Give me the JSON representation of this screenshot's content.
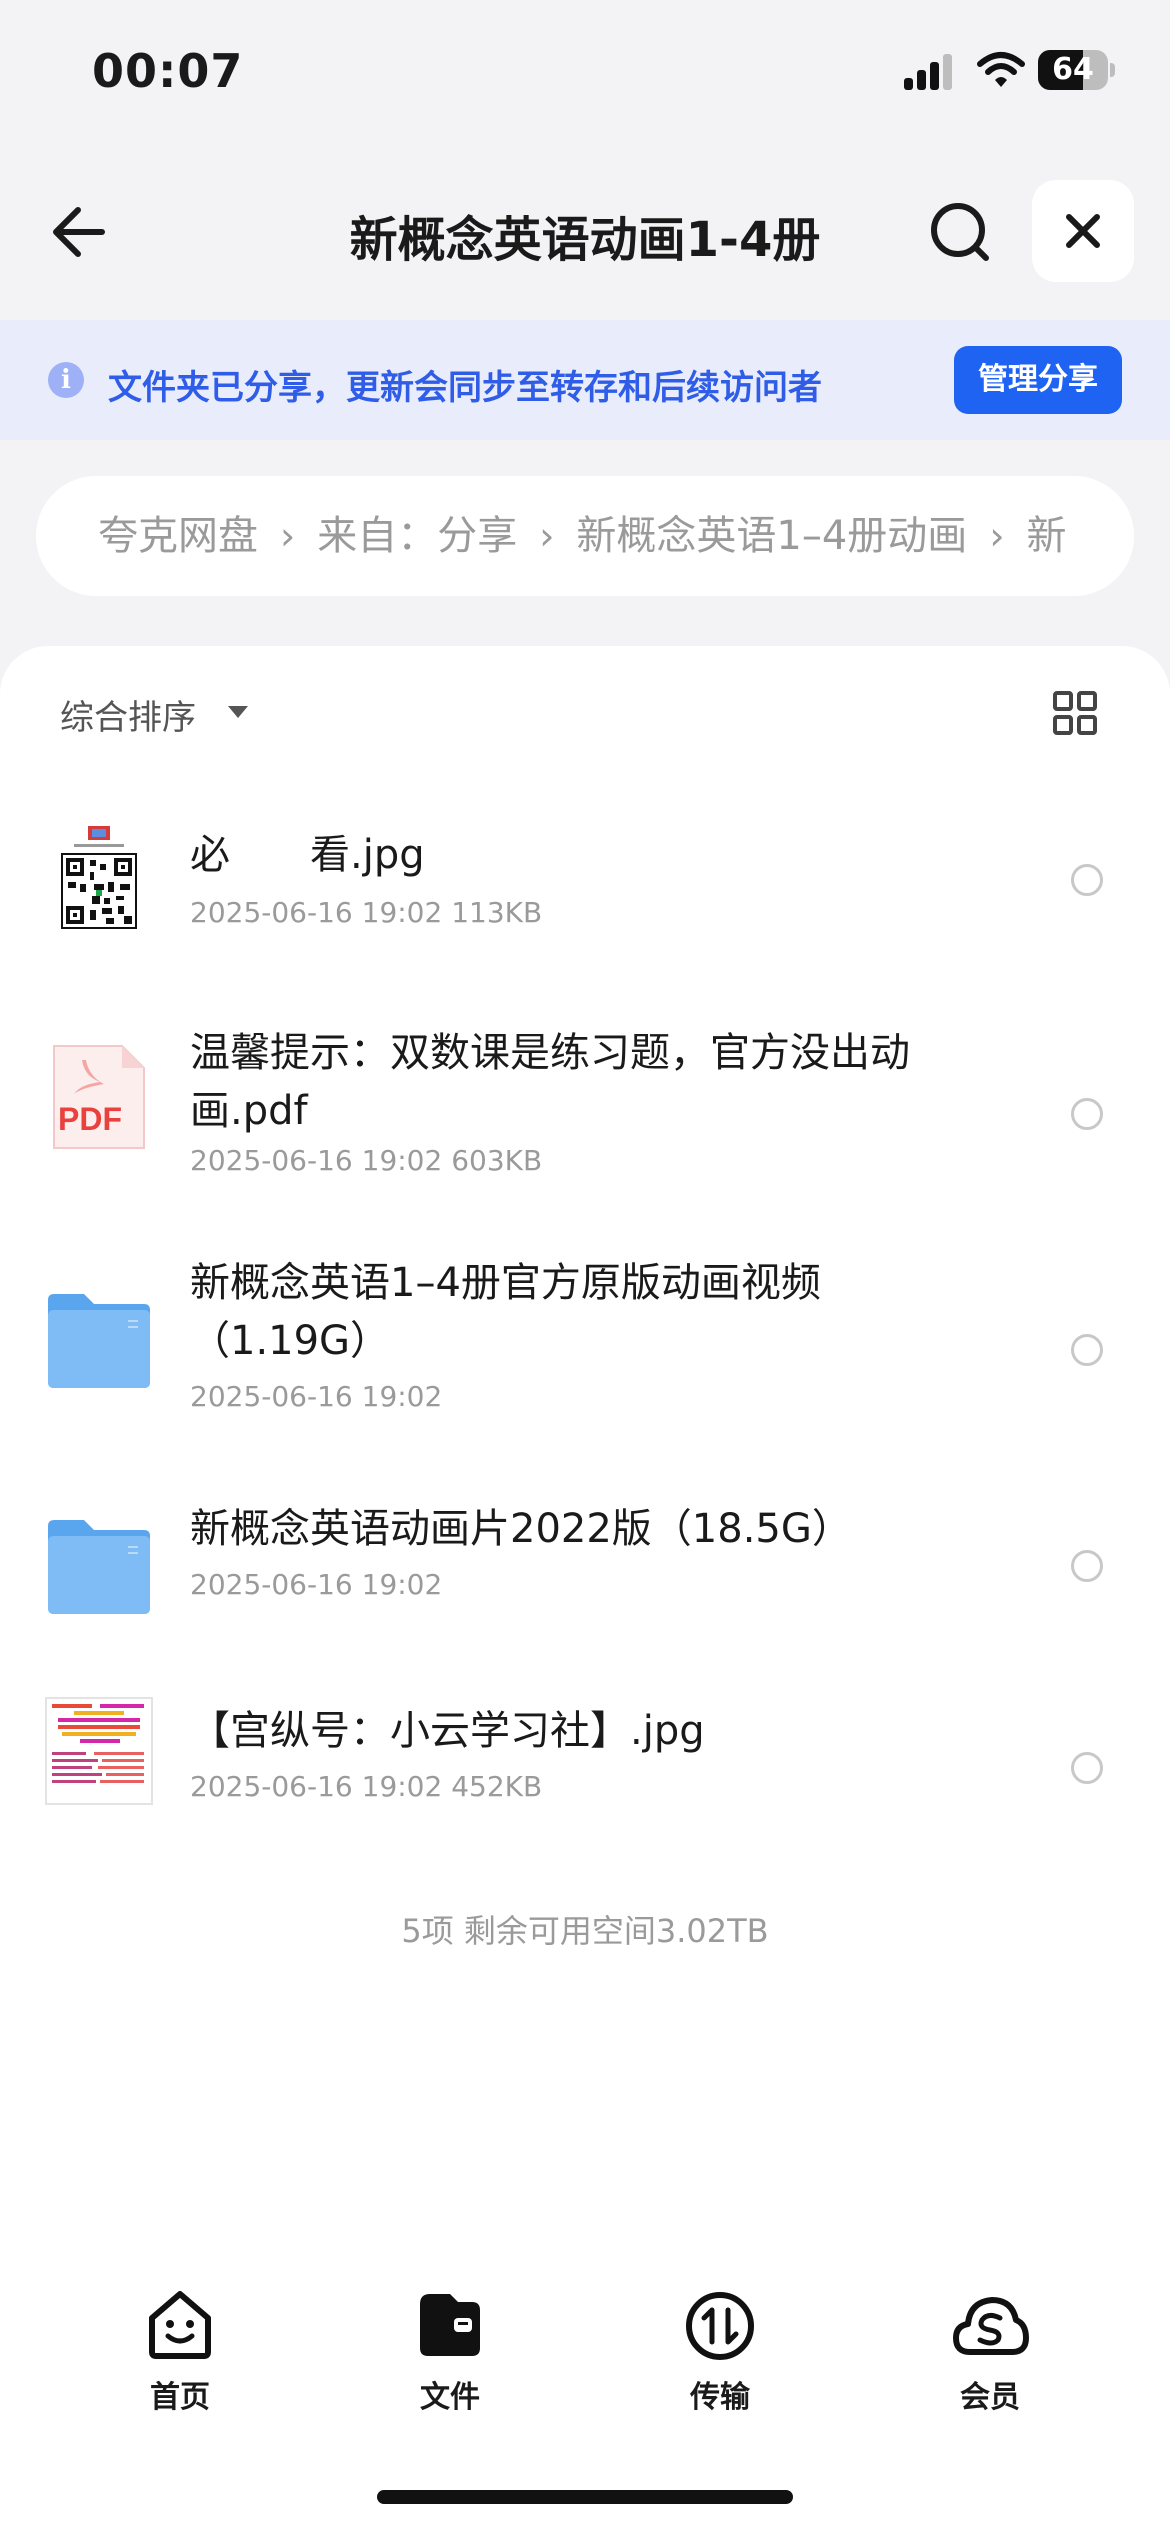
{
  "status_bar": {
    "time": "00:07",
    "battery": "64",
    "battery_level": 0.64
  },
  "nav": {
    "title": "新概念英语动画1-4册"
  },
  "banner": {
    "info_glyph": "i",
    "text": "文件夹已分享，更新会同步至转存和后续访问者",
    "button": "管理分享"
  },
  "breadcrumb": {
    "items": [
      "夸克网盘",
      "来自：分享",
      "新概念英语1–4册动画",
      "新"
    ],
    "separator": "›"
  },
  "sort": {
    "label": "综合排序"
  },
  "files": [
    {
      "name": "必　　看.jpg",
      "meta": "2025-06-16 19:02  113KB",
      "icon": "qr-image-thumbnail"
    },
    {
      "name": "温馨提示：双数课是练习题，官方没出动画.pdf",
      "meta": "2025-06-16 19:02  603KB",
      "icon": "pdf-icon",
      "badge": "PDF"
    },
    {
      "name": "新概念英语1–4册官方原版动画视频（1.19G）",
      "meta": "2025-06-16 19:02",
      "icon": "folder-icon"
    },
    {
      "name": "新概念英语动画片2022版（18.5G）",
      "meta": "2025-06-16 19:02",
      "icon": "folder-icon"
    },
    {
      "name": "【宫纵号：小云学习社】.jpg",
      "meta": "2025-06-16 19:02  452KB",
      "icon": "image-thumbnail"
    }
  ],
  "summary": "5项 剩余可用空间3.02TB",
  "tabbar": {
    "items": [
      {
        "label": "首页",
        "icon": "smile-home-icon"
      },
      {
        "label": "文件",
        "icon": "folder-file-icon"
      },
      {
        "label": "传输",
        "icon": "transfer-icon"
      },
      {
        "label": "会员",
        "icon": "cloud-member-icon"
      }
    ]
  },
  "colors": {
    "accent": "#1f63f2",
    "banner_bg": "#e9ecfb",
    "folder": "#6fb1f3",
    "pdf_red": "#e8413e"
  }
}
